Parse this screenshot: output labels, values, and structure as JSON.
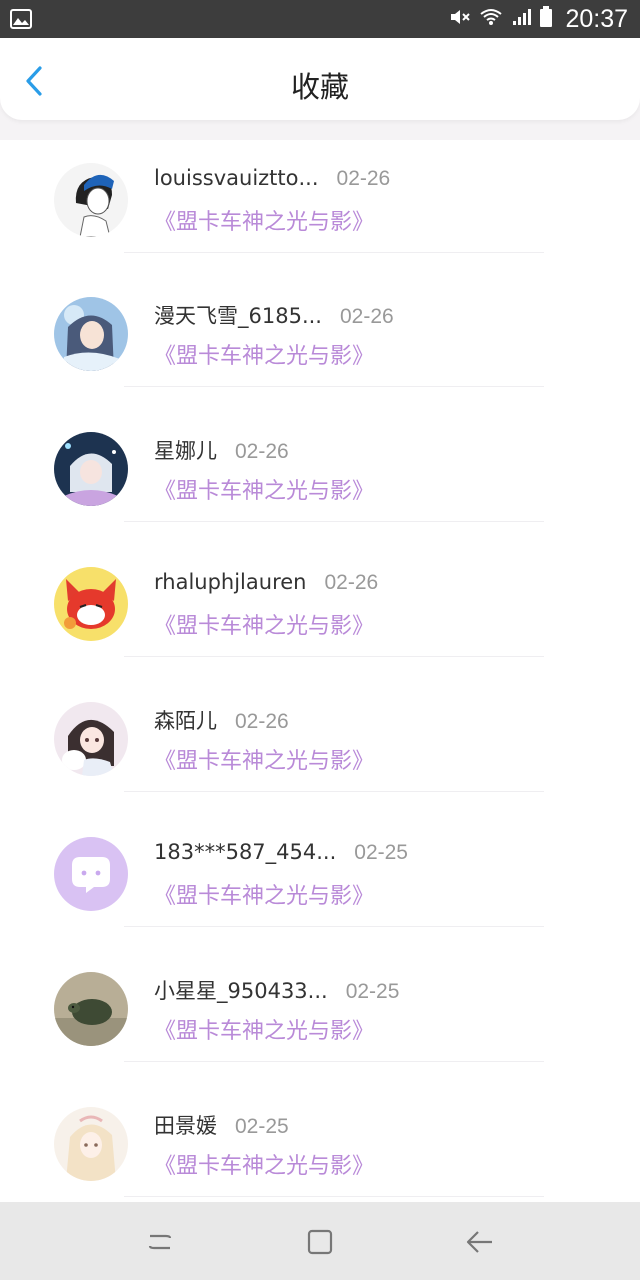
{
  "status_bar": {
    "time": "20:37",
    "icons": [
      "gallery-icon",
      "mute-icon",
      "wifi-icon",
      "signal-icon",
      "battery-icon"
    ]
  },
  "header": {
    "title": "收藏",
    "back_icon": "chevron-left-icon"
  },
  "items": [
    {
      "name": "louissvauizttо...",
      "date": "02-26",
      "topic": "《盟卡车神之光与影》",
      "avatar": "avatar-boy-blue-hat"
    },
    {
      "name": "漫天飞雪_6185...",
      "date": "02-26",
      "topic": "《盟卡车神之光与影》",
      "avatar": "avatar-anime-blue"
    },
    {
      "name": "星娜儿",
      "date": "02-26",
      "topic": "《盟卡车神之光与影》",
      "avatar": "avatar-anime-night"
    },
    {
      "name": "rhaluphjlauren",
      "date": "02-26",
      "topic": "《盟卡车神之光与影》",
      "avatar": "avatar-red-fox"
    },
    {
      "name": "森陌儿",
      "date": "02-26",
      "topic": "《盟卡车神之光与影》",
      "avatar": "avatar-girl-dog"
    },
    {
      "name": "183***587_454...",
      "date": "02-25",
      "topic": "《盟卡车神之光与影》",
      "avatar": "avatar-default-chat"
    },
    {
      "name": "小星星_950433...",
      "date": "02-25",
      "topic": "《盟卡车神之光与影》",
      "avatar": "avatar-turtle-photo"
    },
    {
      "name": "田景媛",
      "date": "02-25",
      "topic": "《盟卡车神之光与影》",
      "avatar": "avatar-anime-girl-light"
    }
  ],
  "nav_bar": {
    "icons": [
      "recent-apps-icon",
      "home-icon",
      "back-arrow-icon"
    ]
  },
  "colors": {
    "topic": "#b98ad8",
    "back": "#2a9de8",
    "default_avatar": "#d9c2f3"
  }
}
